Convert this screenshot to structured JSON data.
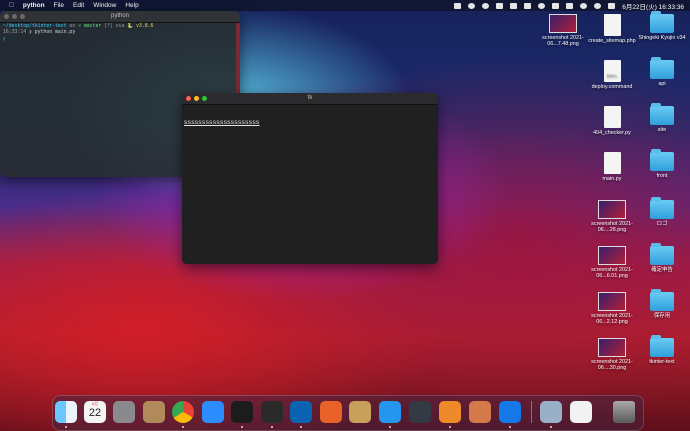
{
  "menubar": {
    "apple_icon": "apple-logo-icon",
    "items": [
      "python",
      "File",
      "Edit",
      "Window",
      "Help"
    ],
    "clock": "6月22日(火)  16:33:36"
  },
  "terminal": {
    "title": "python",
    "lines": [
      {
        "path": "~/desktop/tkinter-text",
        "on": " on ",
        "branch": "master",
        "status": " [?] via ",
        "ver": "v3.8.6"
      },
      {
        "time": "16:33:14",
        "cmd": " ❯ python main.py"
      },
      {
        "cursor": "▯"
      }
    ]
  },
  "tk_window": {
    "title": "tk",
    "label_text": "sssssssssssssssssssss"
  },
  "desktop_icons": [
    {
      "label": "screenshot 2021-06...7.48.png",
      "kind": "screenshot"
    },
    {
      "label": "create_sitemap.php",
      "kind": "doc",
      "tag": ""
    },
    {
      "label": "Shingeki Kyojin v34",
      "kind": "folder"
    },
    {
      "label": "deploy.command",
      "kind": "doc",
      "tag": "SHELL"
    },
    {
      "label": "api",
      "kind": "folder"
    },
    {
      "label": "404_checker.py",
      "kind": "doc",
      "tag": ""
    },
    {
      "label": "site",
      "kind": "folder"
    },
    {
      "label": "main.py",
      "kind": "doc",
      "tag": ""
    },
    {
      "label": "front",
      "kind": "folder"
    },
    {
      "label": "screenshot 2021-06....28.png",
      "kind": "screenshot"
    },
    {
      "label": "ロゴ",
      "kind": "folder"
    },
    {
      "label": "screenshot 2021-06...6.01.png",
      "kind": "screenshot"
    },
    {
      "label": "確定申告",
      "kind": "folder"
    },
    {
      "label": "screenshot 2021-06...2.12.png",
      "kind": "screenshot"
    },
    {
      "label": "保存用",
      "kind": "folder"
    },
    {
      "label": "screenshot 2021-06....30.png",
      "kind": "screenshot"
    },
    {
      "label": "tkinter-text",
      "kind": "folder"
    }
  ],
  "dock": {
    "calendar_month": "6月",
    "calendar_day": "22",
    "apps": [
      {
        "name": "finder-icon",
        "color": "#3aa0f0"
      },
      {
        "name": "calendar-icon",
        "color": "#f5f5f5"
      },
      {
        "name": "system-preferences-icon",
        "color": "#8a8a8e"
      },
      {
        "name": "contacts-icon",
        "color": "#b08a5a"
      },
      {
        "name": "chrome-icon",
        "color": "#f5f5f5"
      },
      {
        "name": "zoom-icon",
        "color": "#2d8cff"
      },
      {
        "name": "iterm-icon",
        "color": "#1c1c1c"
      },
      {
        "name": "terminal-icon",
        "color": "#2a2a2a"
      },
      {
        "name": "vscode-icon",
        "color": "#0a63b0"
      },
      {
        "name": "activity-chart-icon",
        "color": "#e8622a"
      },
      {
        "name": "archive-utility-icon",
        "color": "#c9a05a"
      },
      {
        "name": "docker-icon",
        "color": "#2496ed"
      },
      {
        "name": "quicktime-icon",
        "color": "#333a44"
      },
      {
        "name": "sourcetree-icon",
        "color": "#ef8a2a"
      },
      {
        "name": "reminders-icon",
        "color": "#d47a4a"
      },
      {
        "name": "infinity-icon",
        "color": "#1478e8"
      },
      {
        "name": "preview-icon",
        "color": "#9ab0c8"
      },
      {
        "name": "document-icon",
        "color": "#f2f2f2"
      },
      {
        "name": "trash-icon",
        "color": "#6a6a6a"
      }
    ]
  }
}
